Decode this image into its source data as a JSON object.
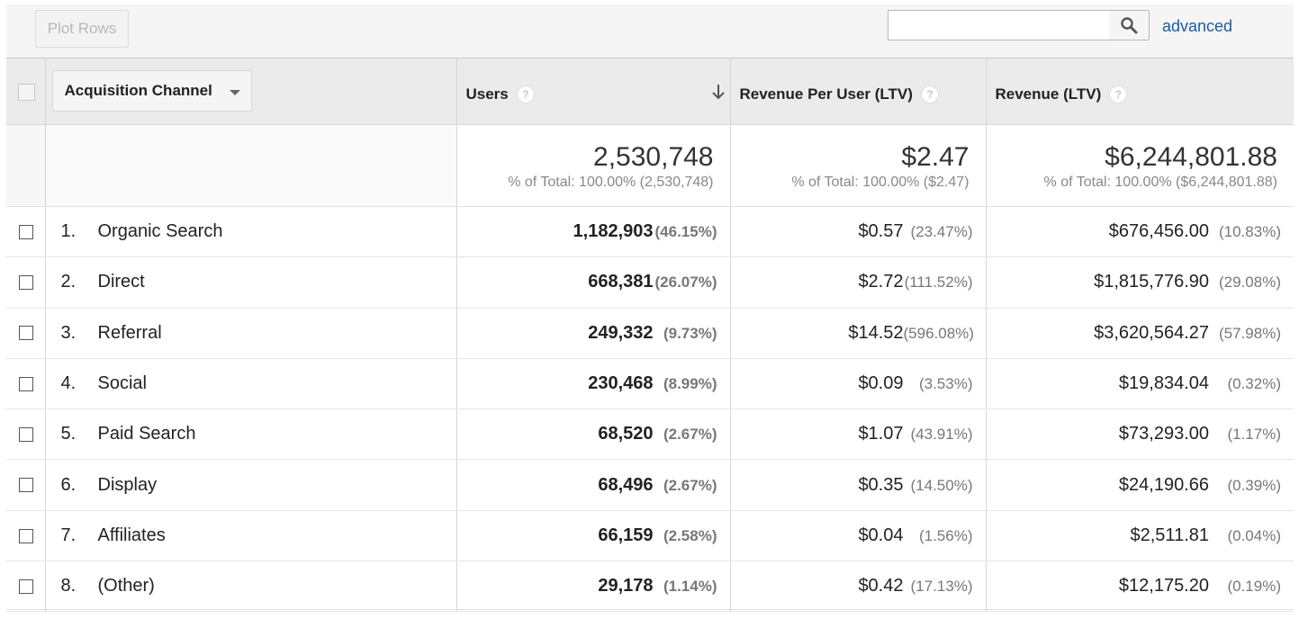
{
  "toolbar": {
    "plot_rows_label": "Plot Rows",
    "search_value": "",
    "search_icon": "magnifier-icon",
    "advanced_label": "advanced"
  },
  "header": {
    "dimension_label": "Acquisition Channel",
    "columns": [
      {
        "label": "Users"
      },
      {
        "label": "Revenue Per User (LTV)"
      },
      {
        "label": "Revenue (LTV)"
      }
    ],
    "help_glyph": "?"
  },
  "totals": {
    "users": "2,530,748",
    "users_sub": "% of Total: 100.00% (2,530,748)",
    "rpu": "$2.47",
    "rpu_sub": "% of Total: 100.00% ($2.47)",
    "revenue": "$6,244,801.88",
    "revenue_sub": "% of Total: 100.00% ($6,244,801.88)"
  },
  "rows": [
    {
      "idx": "1.",
      "channel": "Organic Search",
      "users": "1,182,903",
      "users_pct": "(46.15%)",
      "rpu": "$0.57",
      "rpu_pct": "(23.47%)",
      "rev": "$676,456.00",
      "rev_pct": "(10.83%)"
    },
    {
      "idx": "2.",
      "channel": "Direct",
      "users": "668,381",
      "users_pct": "(26.07%)",
      "rpu": "$2.72",
      "rpu_pct": "(111.52%)",
      "rev": "$1,815,776.90",
      "rev_pct": "(29.08%)"
    },
    {
      "idx": "3.",
      "channel": "Referral",
      "users": "249,332",
      "users_pct": "(9.73%)",
      "rpu": "$14.52",
      "rpu_pct": "(596.08%)",
      "rev": "$3,620,564.27",
      "rev_pct": "(57.98%)"
    },
    {
      "idx": "4.",
      "channel": "Social",
      "users": "230,468",
      "users_pct": "(8.99%)",
      "rpu": "$0.09",
      "rpu_pct": "(3.53%)",
      "rev": "$19,834.04",
      "rev_pct": "(0.32%)"
    },
    {
      "idx": "5.",
      "channel": "Paid Search",
      "users": "68,520",
      "users_pct": "(2.67%)",
      "rpu": "$1.07",
      "rpu_pct": "(43.91%)",
      "rev": "$73,293.00",
      "rev_pct": "(1.17%)"
    },
    {
      "idx": "6.",
      "channel": "Display",
      "users": "68,496",
      "users_pct": "(2.67%)",
      "rpu": "$0.35",
      "rpu_pct": "(14.50%)",
      "rev": "$24,190.66",
      "rev_pct": "(0.39%)"
    },
    {
      "idx": "7.",
      "channel": "Affiliates",
      "users": "66,159",
      "users_pct": "(2.58%)",
      "rpu": "$0.04",
      "rpu_pct": "(1.56%)",
      "rev": "$2,511.81",
      "rev_pct": "(0.04%)"
    },
    {
      "idx": "8.",
      "channel": "(Other)",
      "users": "29,178",
      "users_pct": "(1.14%)",
      "rpu": "$0.42",
      "rpu_pct": "(17.13%)",
      "rev": "$12,175.20",
      "rev_pct": "(0.19%)"
    }
  ]
}
